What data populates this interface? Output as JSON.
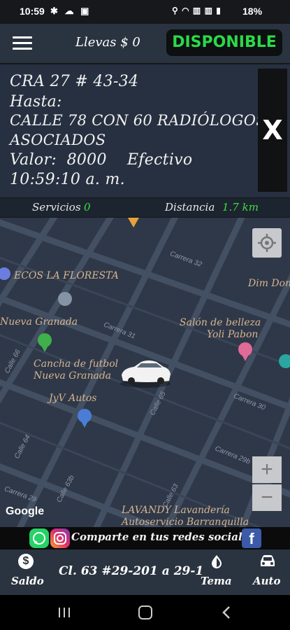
{
  "status_bar": {
    "time": "10:59",
    "left_icons": "✱ ☁ ▣",
    "right_icons": "⚲ ◠ ▥ ▥ ▮",
    "battery": "18%"
  },
  "header": {
    "earnings": "Llevas $ 0",
    "availability": "DISPONIBLE",
    "availability_color": "#2bd94a"
  },
  "trip": {
    "origin": "CRA 27 # 43-34",
    "to_label": "Hasta:",
    "destination_line1": "CALLE 78 CON 60 RADIÓLOGOS",
    "destination_line2": "ASOCIADOS",
    "value_line": "Valor:  8000    Efectivo",
    "time": "10:59:10 a. m.",
    "close": "X"
  },
  "stats": {
    "services_label": "Servicios",
    "services_value": "0",
    "distance_label": "Distancia",
    "distance_value": "1.7 km"
  },
  "map": {
    "places": {
      "ecos": "ECOS LA FLORESTA",
      "dim": "Dim Dom",
      "nueva_granada": "Nueva Granada",
      "salon1": "Salón de belleza",
      "salon2": "Yoli Pabon",
      "cancha1": "Cancha de futbol",
      "cancha2": "Nueva Granada",
      "jyv": "JyV Autos",
      "lavandy1": "LAVANDY Lavandería",
      "lavandy2": "Autoservicio Barranquilla"
    },
    "streets": {
      "carrera32": "Carrera 32",
      "carrera31": "Carrera 31",
      "carrera30": "Carrera 30",
      "carrera29b": "Carrera 29b",
      "carrera29": "Carrera 29",
      "calle65": "Calle 65",
      "calle64": "Calle 64",
      "calle63b": "Calle 63b",
      "calle63": "Calle 63",
      "calle66": "Calle 66"
    },
    "zoom_in": "+",
    "zoom_out": "−",
    "attribution": "Google"
  },
  "share": {
    "text": "Comparte en tus redes sociales"
  },
  "toolbar": {
    "balance_label": "Saldo",
    "address": "Cl. 63 #29-201 a 29-1",
    "theme_label": "Tema",
    "auto_label": "Auto"
  }
}
